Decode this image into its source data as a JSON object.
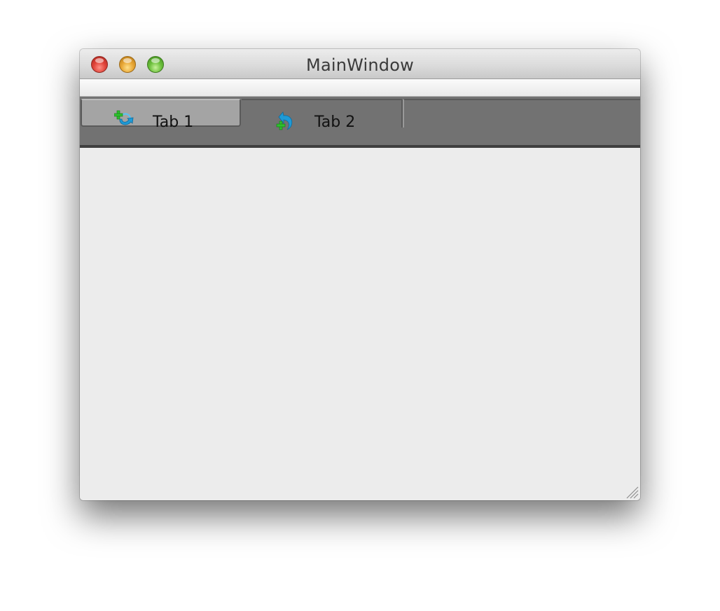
{
  "window": {
    "title": "MainWindow"
  },
  "tabs": [
    {
      "label": "Tab 1",
      "icon": "add-refresh-icon",
      "selected": true
    },
    {
      "label": "Tab 2",
      "icon": "add-undo-icon",
      "selected": false
    }
  ],
  "colors": {
    "tabbar_background": "#727272",
    "selected_tab": "#a4a4a4",
    "content_background": "#ececec"
  }
}
